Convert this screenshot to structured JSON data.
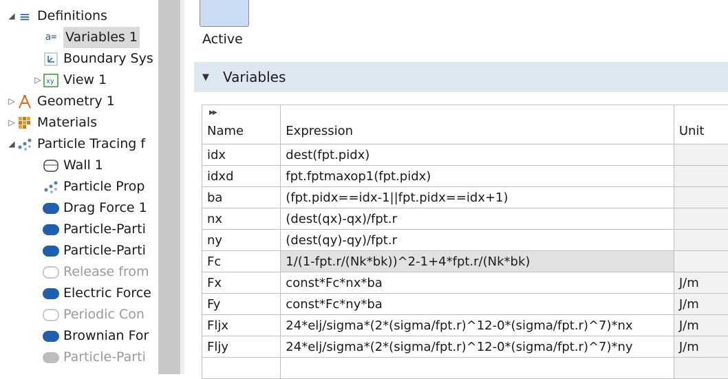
{
  "tree": {
    "items": [
      {
        "label": "Definitions",
        "icon": "list-icon",
        "expander": "expanded"
      },
      {
        "label": "Variables 1",
        "icon": "variables-icon",
        "expander": "none",
        "selected": true
      },
      {
        "label": "Boundary Sys",
        "icon": "coordinate-system-icon",
        "expander": "none"
      },
      {
        "label": "View 1",
        "icon": "view-icon",
        "expander": "collapsed"
      },
      {
        "label": "Geometry 1",
        "icon": "geometry-icon",
        "expander": "collapsed"
      },
      {
        "label": "Materials",
        "icon": "materials-icon",
        "expander": "collapsed"
      },
      {
        "label": "Particle Tracing f",
        "icon": "particle-tracing-icon",
        "expander": "expanded"
      },
      {
        "label": "Wall 1",
        "icon": "wall-icon",
        "expander": "none"
      },
      {
        "label": "Particle Prop",
        "icon": "particle-properties-icon",
        "expander": "none"
      },
      {
        "label": "Drag Force 1",
        "icon": "force-icon",
        "expander": "none"
      },
      {
        "label": "Particle-Parti",
        "icon": "force-icon",
        "expander": "none"
      },
      {
        "label": "Particle-Parti",
        "icon": "force-icon",
        "expander": "none"
      },
      {
        "label": "Release from",
        "icon": "release-icon",
        "expander": "none",
        "disabled": true
      },
      {
        "label": "Electric Force",
        "icon": "force-icon",
        "expander": "none"
      },
      {
        "label": "Periodic Con",
        "icon": "periodic-condition-icon",
        "expander": "none",
        "disabled": true
      },
      {
        "label": "Brownian For",
        "icon": "force-icon",
        "expander": "none"
      },
      {
        "label": "Particle-Parti",
        "icon": "force-icon",
        "expander": "none",
        "disabled": true
      }
    ]
  },
  "panel": {
    "active_label": "Active",
    "section_title": "Variables",
    "table": {
      "columns": [
        "Name",
        "Expression",
        "Unit"
      ],
      "rows": [
        {
          "name": "idx",
          "expression": "dest(fpt.pidx)",
          "unit": ""
        },
        {
          "name": "idxd",
          "expression": "fpt.fptmaxop1(fpt.pidx)",
          "unit": ""
        },
        {
          "name": "ba",
          "expression": "(fpt.pidx==idx-1||fpt.pidx==idx+1)",
          "unit": ""
        },
        {
          "name": "nx",
          "expression": "(dest(qx)-qx)/fpt.r",
          "unit": ""
        },
        {
          "name": "ny",
          "expression": "(dest(qy)-qy)/fpt.r",
          "unit": ""
        },
        {
          "name": "Fc",
          "expression": "1/(1-fpt.r/(Nk*bk))^2-1+4*fpt.r/(Nk*bk)",
          "unit": "",
          "selected": true
        },
        {
          "name": "Fx",
          "expression": "const*Fc*nx*ba",
          "unit": "J/m"
        },
        {
          "name": "Fy",
          "expression": "const*Fc*ny*ba",
          "unit": "J/m"
        },
        {
          "name": "Fljx",
          "expression": "24*elj/sigma*(2*(sigma/fpt.r)^12-0*(sigma/fpt.r)^7)*nx",
          "unit": "J/m"
        },
        {
          "name": "Fljy",
          "expression": "24*elj/sigma*(2*(sigma/fpt.r)^12-0*(sigma/fpt.r)^7)*ny",
          "unit": "J/m"
        },
        {
          "name": "",
          "expression": "",
          "unit": ""
        }
      ]
    }
  },
  "colors": {
    "accent": "#1f5fb0",
    "section_header": "#dde7f2",
    "splitter": "#c8c8c8"
  }
}
